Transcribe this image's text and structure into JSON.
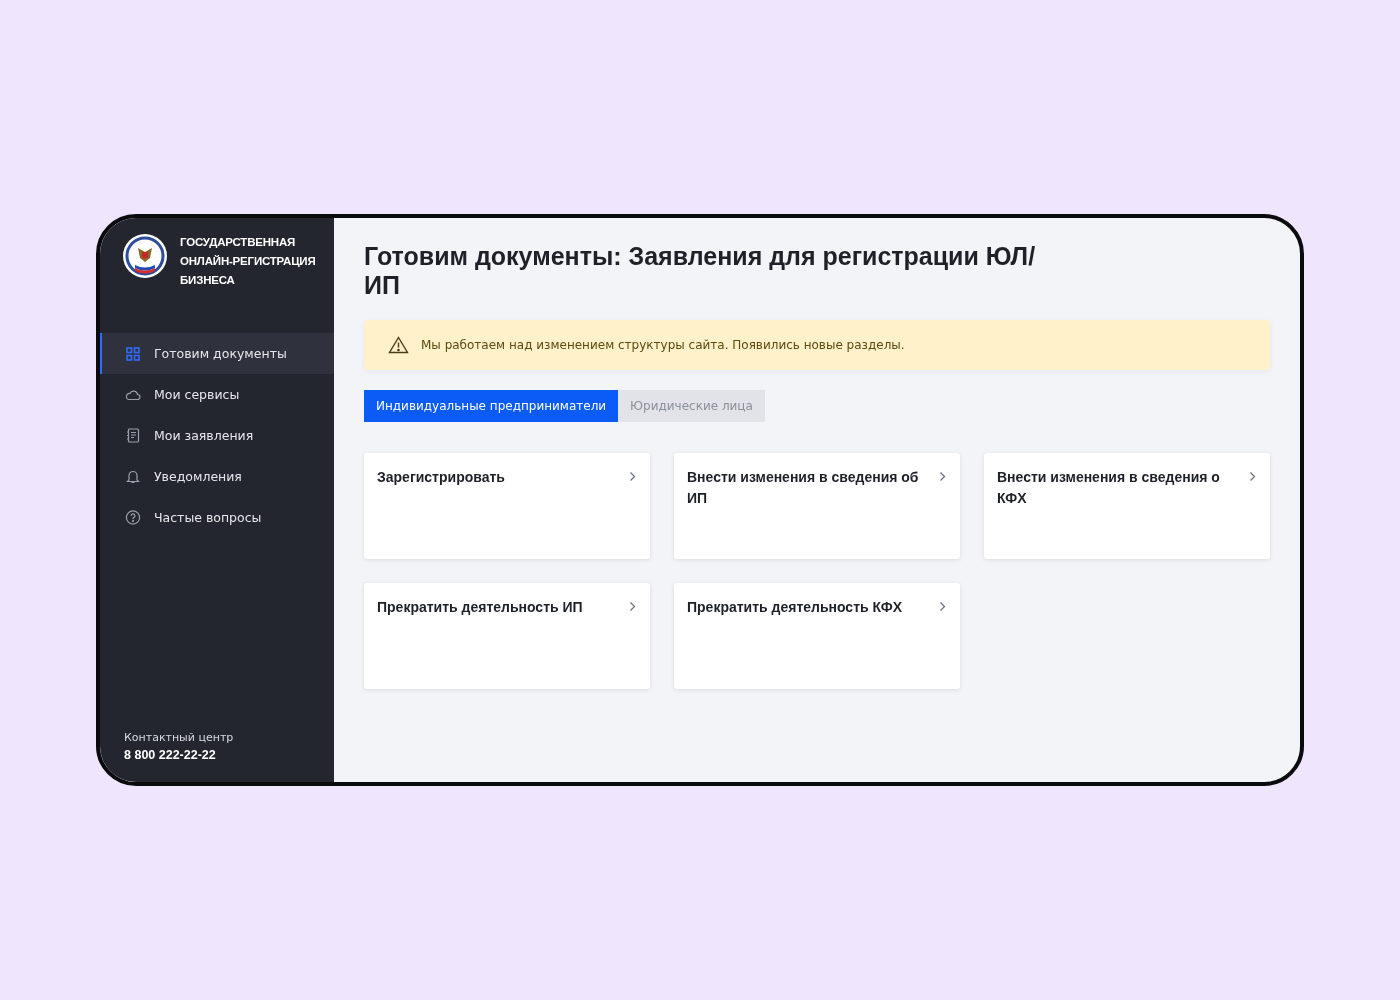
{
  "brand": {
    "lines": [
      "ГОСУДАРСТВЕННАЯ",
      "ОНЛАЙН-РЕГИСТРАЦИЯ",
      "БИЗНЕСА"
    ]
  },
  "sidebar": {
    "items": [
      {
        "label": "Готовим документы",
        "selected": true
      },
      {
        "label": "Мои сервисы",
        "selected": false
      },
      {
        "label": "Мои заявления",
        "selected": false
      },
      {
        "label": "Уведомления",
        "selected": false
      },
      {
        "label": "Частые вопросы",
        "selected": false
      }
    ],
    "contact": {
      "label": "Контактный центр",
      "phone": "8 800 222-22-22"
    }
  },
  "title": "Готовим документы: Заявления для регистрации ЮЛ/ИП",
  "notice": "Мы работаем над изменением структуры сайта. Появились новые разделы.",
  "tabs": [
    {
      "label": "Индивидуальные предприниматели",
      "selected": true
    },
    {
      "label": "Юридические лица",
      "selected": false
    }
  ],
  "cards": [
    {
      "title": "Зарегистрировать"
    },
    {
      "title": "Внести изменения в сведения об ИП"
    },
    {
      "title": "Внести изменения в сведения о КФХ"
    },
    {
      "title": "Прекратить деятельность ИП"
    },
    {
      "title": "Прекратить деятельность КФХ"
    }
  ]
}
